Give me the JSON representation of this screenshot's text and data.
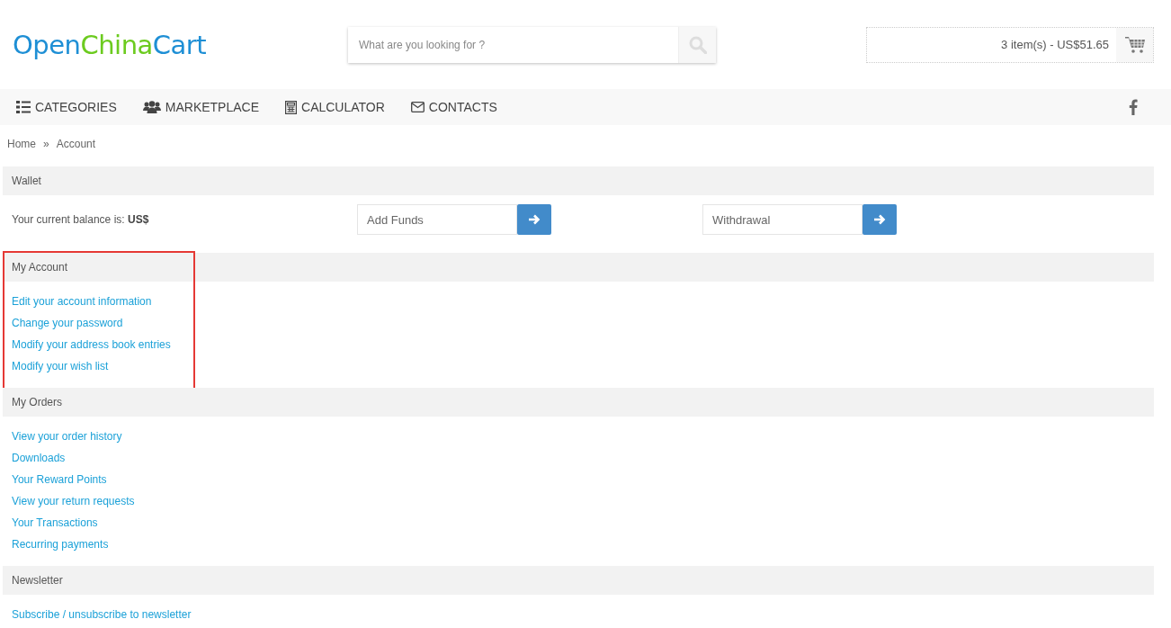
{
  "logo": {
    "parts": [
      {
        "text": "Open",
        "color": "#1e8fd5"
      },
      {
        "text": "China",
        "color": "#6ccb1f"
      },
      {
        "text": "Cart",
        "color": "#1e8fd5"
      }
    ]
  },
  "search": {
    "placeholder": "What are you looking for ?"
  },
  "cart": {
    "summary": "3 item(s) - US$51.65"
  },
  "nav": [
    {
      "label": "CATEGORIES"
    },
    {
      "label": "MARKETPLACE"
    },
    {
      "label": "CALCULATOR"
    },
    {
      "label": "CONTACTS"
    }
  ],
  "breadcrumb": [
    "Home",
    "Account"
  ],
  "breadcrumb_separator": "»",
  "wallet": {
    "title": "Wallet",
    "balance": "Your current balance is: **US$**",
    "fields": [
      {
        "placeholder": "Add Funds"
      },
      {
        "placeholder": "Withdrawal"
      }
    ]
  },
  "sections": [
    {
      "title": "My Account",
      "highlighted": true,
      "links": [
        "Edit your account information",
        "Change your password",
        "Modify your address book entries",
        "Modify your wish list"
      ]
    },
    {
      "title": "My Orders",
      "highlighted": false,
      "links": [
        "View your order history",
        "Downloads",
        "Your Reward Points",
        "View your return requests",
        "Your Transactions",
        "Recurring payments"
      ]
    },
    {
      "title": "Newsletter",
      "highlighted": false,
      "links": [
        "Subscribe / unsubscribe to newsletter"
      ]
    }
  ]
}
